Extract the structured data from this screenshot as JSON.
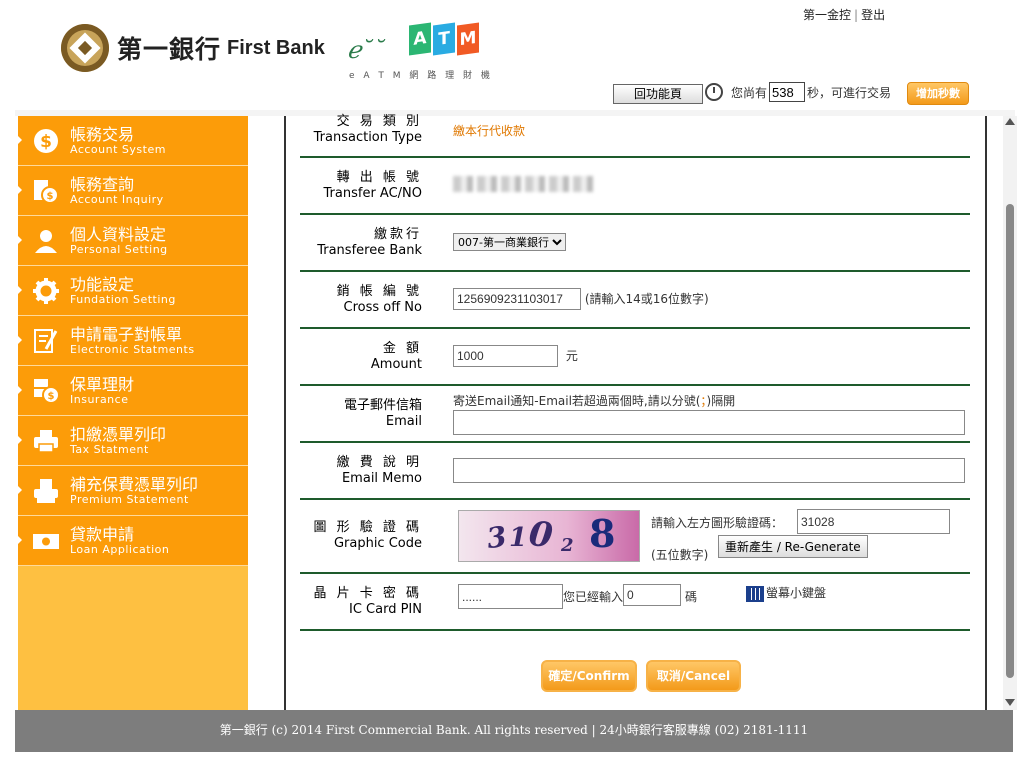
{
  "header": {
    "top_links": {
      "group": "第一金控",
      "logout": "登出"
    },
    "bank_name_cn": "第一銀行",
    "bank_name_en": "First Bank",
    "eatm_letters": [
      "e",
      "A",
      "T",
      "M"
    ],
    "eatm_colors": [
      "#f5a623",
      "#2bb673",
      "#29abe2",
      "#f15a24"
    ],
    "eatm_sub": "e A T M 網 路 理 財 機",
    "home_button": "回功能頁",
    "timer_prefix": "您尚有",
    "timer_value": "538",
    "timer_suffix": "秒，可進行交易",
    "add_seconds_button": "增加秒數"
  },
  "sidebar": {
    "items": [
      {
        "cn": "帳務交易",
        "en": "Account System",
        "icon": "dollar-coin-icon"
      },
      {
        "cn": "帳務查詢",
        "en": "Account Inquiry",
        "icon": "inquiry-icon"
      },
      {
        "cn": "個人資料設定",
        "en": "Personal Setting",
        "icon": "person-icon"
      },
      {
        "cn": "功能設定",
        "en": "Fundation Setting",
        "icon": "gear-icon"
      },
      {
        "cn": "申請電子對帳單",
        "en": "Electronic Statments",
        "icon": "pen-document-icon"
      },
      {
        "cn": "保單理財",
        "en": "Insurance",
        "icon": "insurance-coin-icon"
      },
      {
        "cn": "扣繳憑單列印",
        "en": "Tax Statment",
        "icon": "printer-icon"
      },
      {
        "cn": "補充保費憑單列印",
        "en": "Premium Statement",
        "icon": "receipt-printer-icon"
      },
      {
        "cn": "貸款申請",
        "en": "Loan Application",
        "icon": "cash-icon"
      }
    ]
  },
  "form": {
    "transaction_type": {
      "cn": "交 易 類 別",
      "en": "Transaction Type",
      "value": "繳本行代收款"
    },
    "transfer_account": {
      "cn": "轉 出 帳 號",
      "en": "Transfer AC/NO"
    },
    "transferee_bank": {
      "cn": "繳款行",
      "en": "Transferee Bank",
      "selected": "007-第一商業銀行"
    },
    "cross_off": {
      "cn": "銷 帳 編 號",
      "en": "Cross off No",
      "value": "1256909231103017",
      "hint": "(請輸入14或16位數字)"
    },
    "amount": {
      "cn": "金 額",
      "en": "Amount",
      "value": "1000",
      "unit": "元"
    },
    "email": {
      "cn": "電子郵件信箱",
      "en": "Email",
      "hint_before": "寄送Email通知-Email若超過兩個時,請以分號(",
      "hint_sep": "；",
      "hint_after": ")隔開",
      "value": ""
    },
    "email_memo": {
      "cn": "繳 費 說 明",
      "en": "Email Memo",
      "value": ""
    },
    "graphic_code": {
      "cn": "圖 形 驗 證 碼",
      "en": "Graphic Code",
      "prompt": "請輸入左方圖形驗證碼：",
      "value": "31028",
      "digits_note": "(五位數字)",
      "regen_button": "重新產生 / Re-Generate",
      "captcha_chars": [
        "3",
        "1",
        "0",
        "2",
        "8"
      ]
    },
    "ic_pin": {
      "cn": "晶 片 卡 密 碼",
      "en": "IC Card PIN",
      "value": "......",
      "entered_prefix": "您已經輸入",
      "entered_count": "0",
      "entered_suffix": "碼",
      "keyboard_label": "螢幕小鍵盤"
    }
  },
  "actions": {
    "confirm": "確定/Confirm",
    "cancel": "取消/Cancel"
  },
  "footer": {
    "text": "第一銀行 (c) 2014 First Commercial Bank. All rights reserved | 24小時銀行客服專線 (02) 2181-1111"
  }
}
